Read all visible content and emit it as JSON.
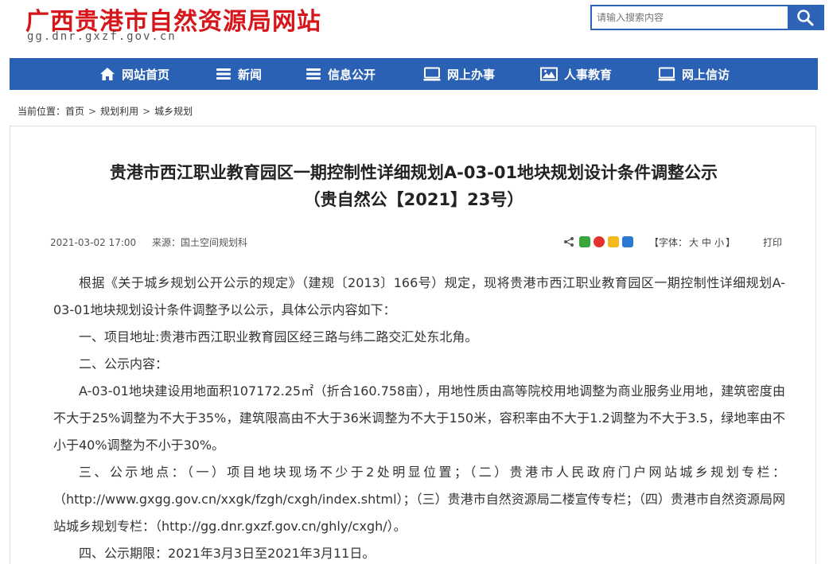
{
  "header": {
    "site_title": "广西贵港市自然资源局网站",
    "site_domain": "gg.dnr.gxzf.gov.cn",
    "search": {
      "placeholder": "请输入搜索内容"
    }
  },
  "nav": {
    "items": [
      {
        "label": "网站首页",
        "icon": "home-icon"
      },
      {
        "label": "新闻",
        "icon": "news-icon"
      },
      {
        "label": "信息公开",
        "icon": "list-icon"
      },
      {
        "label": "网上办事",
        "icon": "monitor-icon"
      },
      {
        "label": "人事教育",
        "icon": "image-icon"
      },
      {
        "label": "网上信访",
        "icon": "monitor-icon"
      }
    ]
  },
  "breadcrumb": {
    "prefix": "当前位置：",
    "items": [
      "首页",
      "规划利用",
      "城乡规划"
    ],
    "separator": ">"
  },
  "article": {
    "title_line1": "贵港市西江职业教育园区一期控制性详细规划A-03-01地块规划设计条件调整公示",
    "title_line2": "（贵自然公【2021】23号）",
    "date": "2021-03-02 17:00",
    "source": "来源：国土空间规划科",
    "font_size_label": "【字体：",
    "font_sizes": [
      "大",
      "中",
      "小"
    ],
    "font_size_close": "】",
    "print": "打印",
    "paragraphs": [
      "根据《关于城乡规划公开公示的规定》（建规〔2013〕166号）规定，现将贵港市西江职业教育园区一期控制性详细规划A-03-01地块规划设计条件调整予以公示，具体公示内容如下：",
      "一、项目地址:贵港市西江职业教育园区经三路与纬二路交汇处东北角。",
      "二、公示内容：",
      "A-03-01地块建设用地面积107172.25㎡（折合160.758亩），用地性质由高等院校用地调整为商业服务业用地，建筑密度由不大于25%调整为不大于35%，建筑限高由不大于36米调整为不大于150米，容积率由不大于1.2调整为不大于3.5，绿地率由不小于40%调整为不小于30%。",
      "三、公示地点：（一）项目地块现场不少于2处明显位置；（二）贵港市人民政府门户网站城乡规划专栏：（http://www.gxgg.gov.cn/xxgk/fzgh/cxgh/index.shtml）；（三）贵港市自然资源局二楼宣传专栏；（四）贵港市自然资源局网站城乡规划专栏：（http://gg.dnr.gxzf.gov.cn/ghly/cxgh/）。",
      "四、公示期限：2021年3月3日至2021年3月11日。"
    ]
  },
  "colors": {
    "brand_red": "#d7161b",
    "nav_blue": "#2a61b5",
    "search_blue": "#2f63b8"
  }
}
